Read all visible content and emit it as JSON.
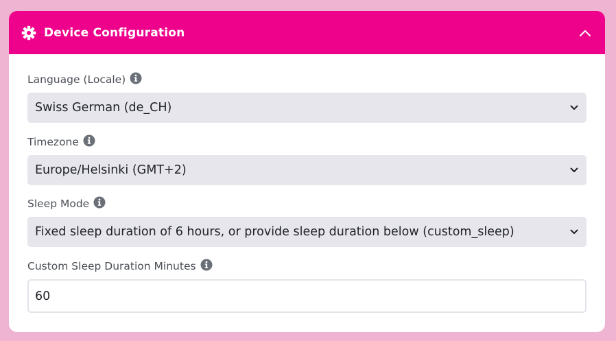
{
  "header": {
    "title": "Device Configuration",
    "icon": "gear-icon",
    "collapse_icon": "chevron-up-icon"
  },
  "fields": {
    "language": {
      "label": "Language (Locale)",
      "value": "Swiss German (de_CH)"
    },
    "timezone": {
      "label": "Timezone",
      "value": "Europe/Helsinki (GMT+2)"
    },
    "sleep_mode": {
      "label": "Sleep Mode",
      "value": "Fixed sleep duration of 6 hours, or provide sleep duration below (custom_sleep)"
    },
    "custom_sleep": {
      "label": "Custom Sleep Duration Minutes",
      "value": "60"
    }
  },
  "colors": {
    "page_background": "#efb4d2",
    "header_background": "#ee028b",
    "select_background": "#e7e6ed",
    "label_text": "#4a4f55"
  }
}
